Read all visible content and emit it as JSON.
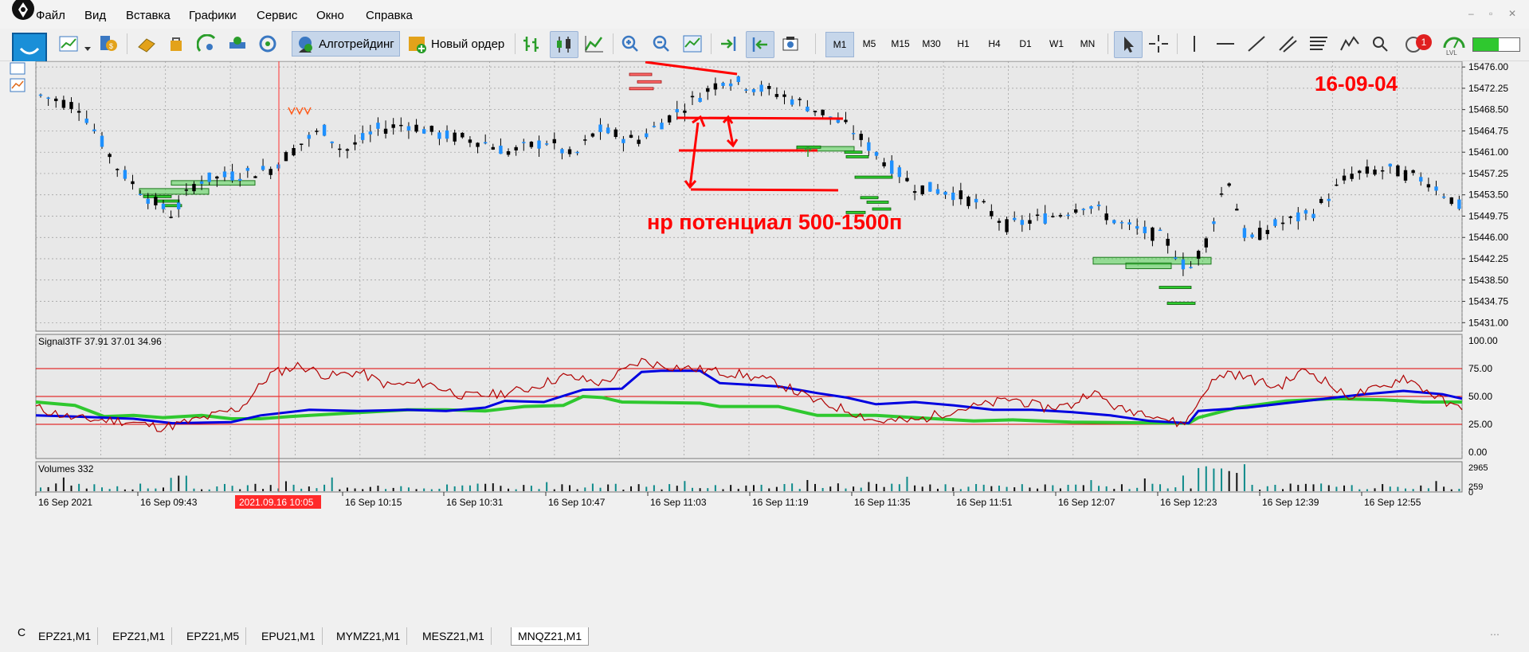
{
  "menu": {
    "items": [
      "Файл",
      "Вид",
      "Вставка",
      "Графики",
      "Сервис",
      "Окно",
      "Справка"
    ]
  },
  "toolbar": {
    "algo_label": "Алготрейдинг",
    "order_label": "Новый ордер",
    "timeframes": [
      "M1",
      "M5",
      "M15",
      "M30",
      "H1",
      "H4",
      "D1",
      "W1",
      "MN"
    ],
    "active_tf": "M1",
    "alert_count": "1",
    "signal_level_label": "LVL"
  },
  "window_controls": {
    "minimize": "–",
    "restore": "▫",
    "close": "✕"
  },
  "price_chart": {
    "price_labels": [
      "15476.00",
      "15472.25",
      "15468.50",
      "15464.75",
      "15461.00",
      "15457.25",
      "15453.50",
      "15449.75",
      "15446.00",
      "15442.25",
      "15438.50",
      "15434.75",
      "15431.00"
    ],
    "annotation_date": "16-09-04",
    "annotation_potential": "нр потенциал 500-1500п",
    "marker_icon": "arrow-up-icon",
    "colors": {
      "bull": "#1e90ff",
      "bear": "#000000",
      "annot": "#ff0000",
      "zone": "#2ecc2e"
    }
  },
  "indicator": {
    "label": "Signal3TF 37.91 37.01 34.96",
    "levels": [
      "100.00",
      "75.00",
      "50.00",
      "25.00",
      "0.00"
    ],
    "colors": {
      "fast": "#b00000",
      "mid": "#0000e0",
      "slow": "#2fc82f",
      "level": "#e00000"
    }
  },
  "volumes": {
    "label": "Volumes 332",
    "levels": [
      "2965",
      "259",
      "0"
    ]
  },
  "time_axis": {
    "labels": [
      "16 Sep 2021",
      "16 Sep 09:43",
      "2021.09.16 10:05",
      "16 Sep 10:15",
      "16 Sep 10:31",
      "16 Sep 10:47",
      "16 Sep 11:03",
      "16 Sep 11:19",
      "16 Sep 11:35",
      "16 Sep 11:51",
      "16 Sep 12:07",
      "16 Sep 12:23",
      "16 Sep 12:39",
      "16 Sep 12:55"
    ],
    "cursor_label": "2021.09.16 10:05"
  },
  "tabs": [
    "EPZ21,M1",
    "EPZ21,M1",
    "EPZ21,M5",
    "EPU21,M1",
    "MYMZ21,M1",
    "MESZ21,M1",
    "MNQZ21,M1"
  ],
  "active_tab": "MNQZ21,M1"
}
